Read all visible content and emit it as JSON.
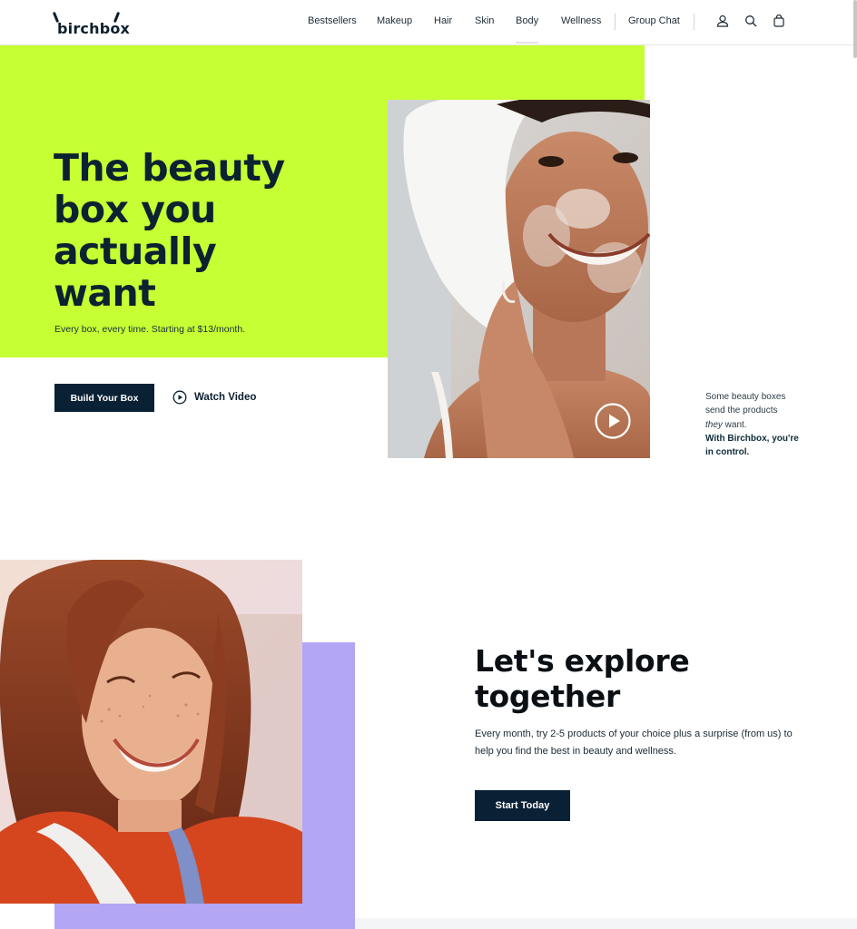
{
  "header": {
    "logo_text": "birchbox",
    "nav": [
      {
        "label": "Bestsellers"
      },
      {
        "label": "Makeup"
      },
      {
        "label": "Hair"
      },
      {
        "label": "Skin"
      },
      {
        "label": "Body"
      },
      {
        "label": "Wellness"
      },
      {
        "label": "Group Chat"
      }
    ],
    "icons": [
      "account-icon",
      "search-icon",
      "bag-icon"
    ]
  },
  "hero": {
    "title": "The beauty box you actually want",
    "subtitle": "Every box, every time. Starting at $13/month.",
    "primary_button": "Build Your Box",
    "video_link": "Watch Video",
    "aside": {
      "line1": "Some beauty boxes",
      "line2": "send the products",
      "line3_em": "they",
      "line3_rest": " want.",
      "line4": "With Birchbox, you're",
      "line5": "in control."
    },
    "accent_color": "#c6ff33"
  },
  "explore": {
    "title": "Let's explore together",
    "body": "Every month, try 2-5 products of your choice plus a surprise (from us) to help you find the best in beauty and wellness.",
    "button": "Start Today",
    "accent_color": "#b3a6f5"
  },
  "colors": {
    "navy": "#0a2035",
    "lime": "#c6ff33",
    "lavender": "#b3a6f5"
  }
}
